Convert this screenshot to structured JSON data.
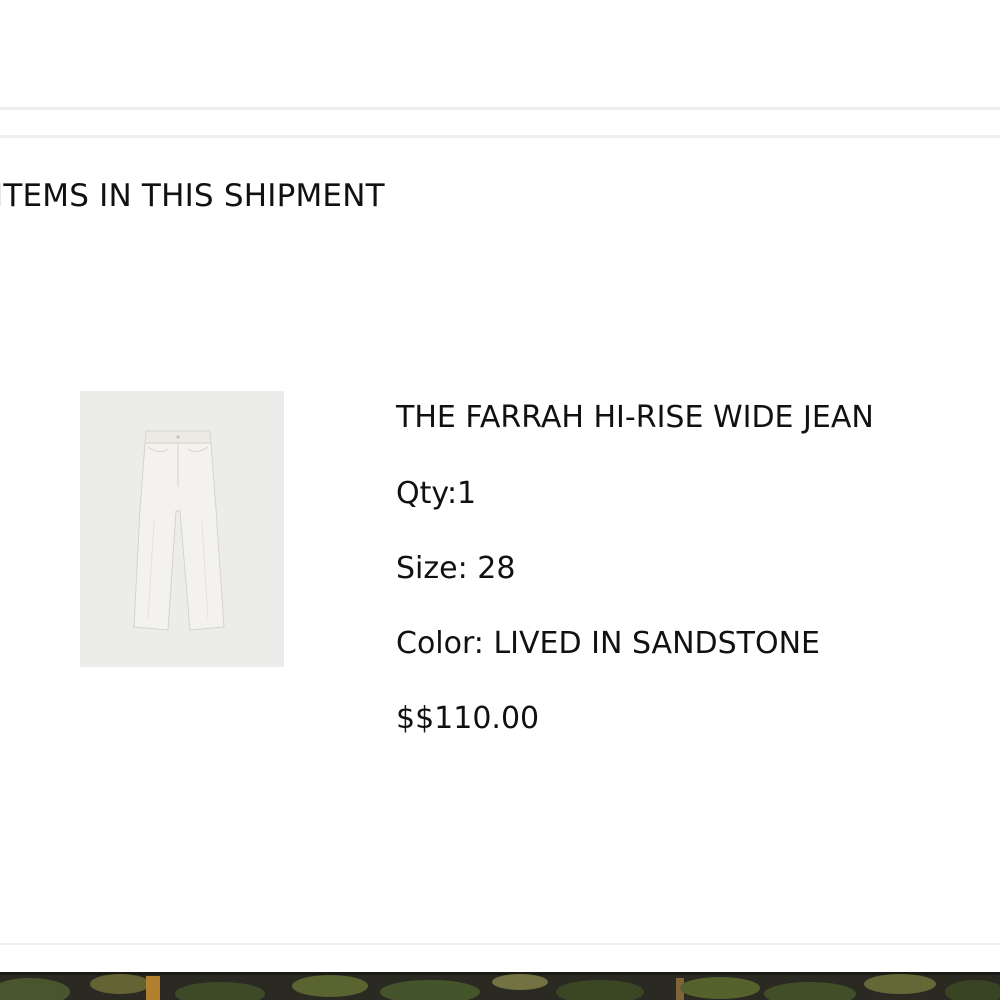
{
  "shipment": {
    "heading": "ITEMS IN THIS SHIPMENT"
  },
  "item": {
    "name": "THE FARRAH HI-RISE WIDE JEAN",
    "qty": "Qty:1",
    "size": "Size: 28",
    "color": "Color: LIVED IN SANDSTONE",
    "price": "$$110.00",
    "image_icon": "jeans-product-image"
  },
  "colors": {
    "divider": "#efefef",
    "thumb_background": "#ececeb",
    "text": "#111111"
  }
}
